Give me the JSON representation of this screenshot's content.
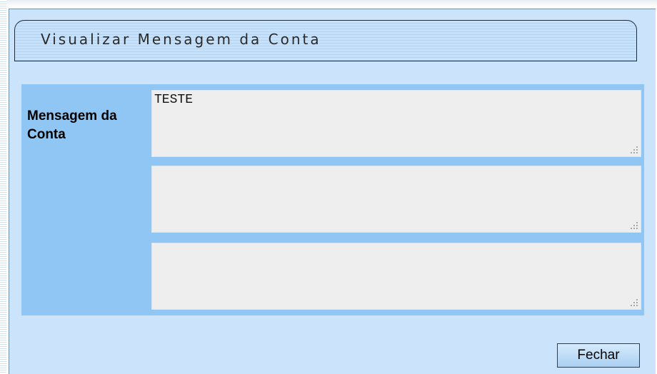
{
  "dialog": {
    "title": "Visualizar Mensagem da Conta"
  },
  "form": {
    "label": "Mensagem da Conta",
    "lines": [
      "TESTE",
      "",
      ""
    ]
  },
  "footer": {
    "close_label": "Fechar"
  },
  "icons": {
    "grip": "resize-grip-icon"
  },
  "colors": {
    "panel_background": "#cbe4fb",
    "content_background": "#90c6f3",
    "field_background": "#eeeeee",
    "title_border": "#1e2b3a"
  }
}
